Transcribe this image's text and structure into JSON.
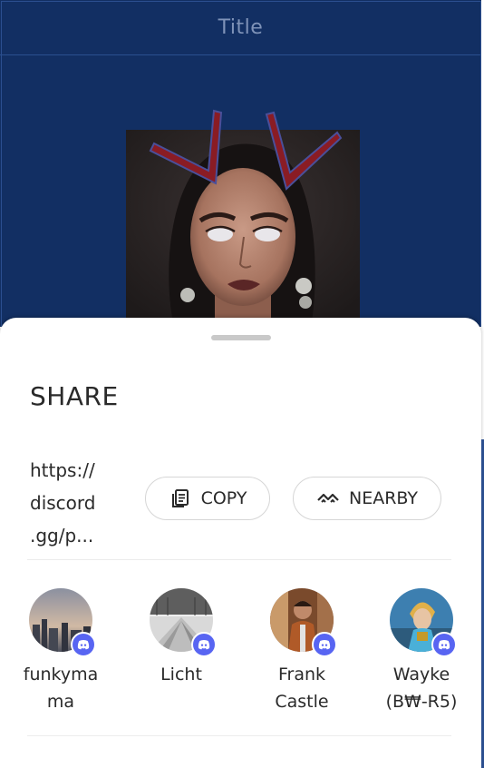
{
  "app": {
    "title": "Title",
    "background_color": "#122f63"
  },
  "share_sheet": {
    "heading": "SHARE",
    "link_lines": [
      "https://",
      "discord",
      ".gg/p..."
    ],
    "copy_button": {
      "label": "COPY",
      "icon": "copy-icon"
    },
    "nearby_button": {
      "label": "NEARBY",
      "icon": "nearby-icon"
    },
    "contacts": [
      {
        "name": "funkymama",
        "display": "funkyma\nma",
        "badge": "discord-icon"
      },
      {
        "name": "Licht",
        "display": "Licht",
        "badge": "discord-icon"
      },
      {
        "name": "Frank Castle",
        "display": "Frank\nCastle",
        "badge": "discord-icon"
      },
      {
        "name": "Wayke (B₩-R5)",
        "display": "Wayke\n(B₩-R5)",
        "badge": "discord-icon"
      }
    ],
    "accent_color": "#5865f2"
  }
}
